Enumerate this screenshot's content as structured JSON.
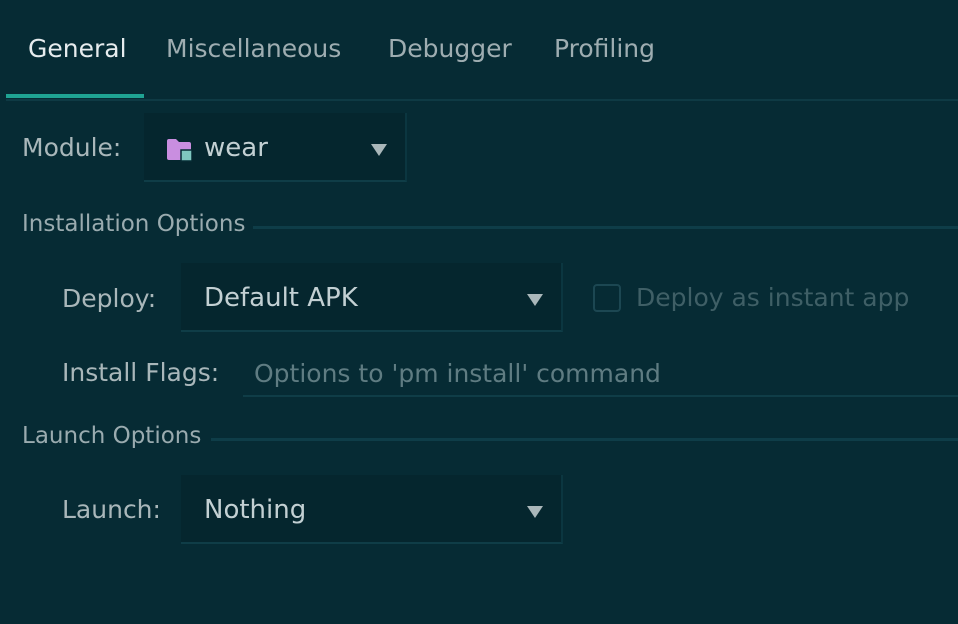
{
  "tabs": [
    {
      "label": "General",
      "active": true
    },
    {
      "label": "Miscellaneous",
      "active": false
    },
    {
      "label": "Debugger",
      "active": false
    },
    {
      "label": "Profiling",
      "active": false
    }
  ],
  "module": {
    "label": "Module:",
    "value": "wear",
    "icon": "folder-module-icon"
  },
  "installation": {
    "title": "Installation Options",
    "deploy_label": "Deploy:",
    "deploy_value": "Default APK",
    "instant_app_label": "Deploy as instant app",
    "instant_app_checked": false,
    "install_flags_label": "Install Flags:",
    "install_flags_value": "",
    "install_flags_placeholder": "Options to 'pm install' command"
  },
  "launch": {
    "title": "Launch Options",
    "launch_label": "Launch:",
    "launch_value": "Nothing"
  },
  "colors": {
    "background": "#062b34",
    "accent": "#1fa393",
    "folder": "#c98ee0",
    "folder_badge": "#7fc8c0"
  }
}
